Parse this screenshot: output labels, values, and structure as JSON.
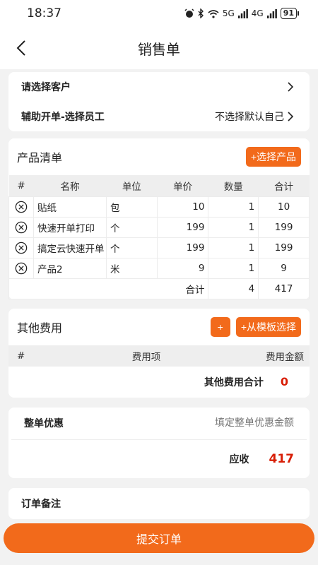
{
  "status_bar": {
    "time": "18:37",
    "battery": "91",
    "net1": "5G",
    "net2": "4G"
  },
  "nav": {
    "title": "销售单"
  },
  "customer": {
    "label": "请选择客户"
  },
  "assist": {
    "label": "辅助开单-选择员工",
    "value": "不选择默认自己"
  },
  "products": {
    "title": "产品清单",
    "add_button": "+选择产品",
    "columns": [
      "#",
      "名称",
      "单位",
      "单价",
      "数量",
      "合计"
    ],
    "rows": [
      {
        "name": "贴纸",
        "unit": "包",
        "price": "10",
        "qty": "1",
        "total": "10"
      },
      {
        "name": "快速开单打印",
        "unit": "个",
        "price": "199",
        "qty": "1",
        "total": "199"
      },
      {
        "name": "搞定云快速开单",
        "unit": "个",
        "price": "199",
        "qty": "1",
        "total": "199"
      },
      {
        "name": "产品2",
        "unit": "米",
        "price": "9",
        "qty": "1",
        "total": "9"
      }
    ],
    "footer": {
      "label": "合计",
      "qty": "4",
      "total": "417"
    }
  },
  "other_fees": {
    "title": "其他费用",
    "add_button": "+",
    "template_button": "+从模板选择",
    "columns": [
      "#",
      "费用项",
      "费用金额"
    ],
    "total_label": "其他费用合计",
    "total_value": "0"
  },
  "discount": {
    "label": "整单优惠",
    "placeholder": "填定整单优惠金额",
    "due_label": "应收",
    "due_value": "417"
  },
  "remark": {
    "label": "订单备注"
  },
  "submit": {
    "label": "提交订单"
  },
  "colors": {
    "accent": "#f26a1b",
    "danger": "#d81e06"
  }
}
